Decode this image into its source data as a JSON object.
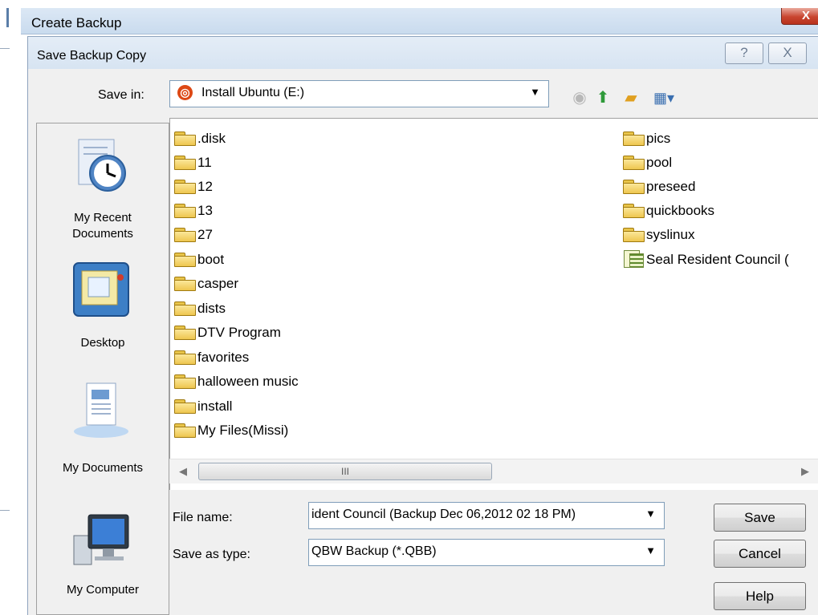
{
  "outer_window": {
    "title": "Create Backup",
    "close_glyph": "X"
  },
  "dialog": {
    "title": "Save Backup Copy",
    "help_glyph": "?",
    "close_glyph": "X"
  },
  "save_in": {
    "label": "Save in:",
    "value": "Install Ubuntu (E:)",
    "icon": "ubuntu-drive-icon"
  },
  "toolbar": {
    "icons": [
      "back-icon",
      "up-folder-icon",
      "new-folder-icon",
      "views-menu-icon"
    ]
  },
  "places": [
    {
      "label_line1": "My Recent",
      "label_line2": "Documents",
      "icon": "recent-documents-icon"
    },
    {
      "label_line1": "Desktop",
      "label_line2": "",
      "icon": "desktop-icon"
    },
    {
      "label_line1": "My Documents",
      "label_line2": "",
      "icon": "my-documents-icon"
    },
    {
      "label_line1": "My Computer",
      "label_line2": "",
      "icon": "my-computer-icon"
    }
  ],
  "files": {
    "column1": [
      ".disk",
      "11",
      "12",
      "13",
      "27",
      "boot",
      "casper",
      "dists",
      "DTV Program",
      "favorites",
      "halloween music",
      "install",
      "My Files(Missi)"
    ],
    "column2": [
      "pics",
      "pool",
      "preseed",
      "quickbooks",
      "syslinux",
      "Seal Resident Council ("
    ]
  },
  "scrollbar": {
    "thumb_grip": "III"
  },
  "file_name": {
    "label": "File name:",
    "value": "ident Council (Backup Dec 06,2012  02 18 PM)"
  },
  "save_as_type": {
    "label": "Save as type:",
    "value": "QBW Backup (*.QBB)"
  },
  "buttons": {
    "save": "Save",
    "cancel": "Cancel",
    "help": "Help"
  }
}
